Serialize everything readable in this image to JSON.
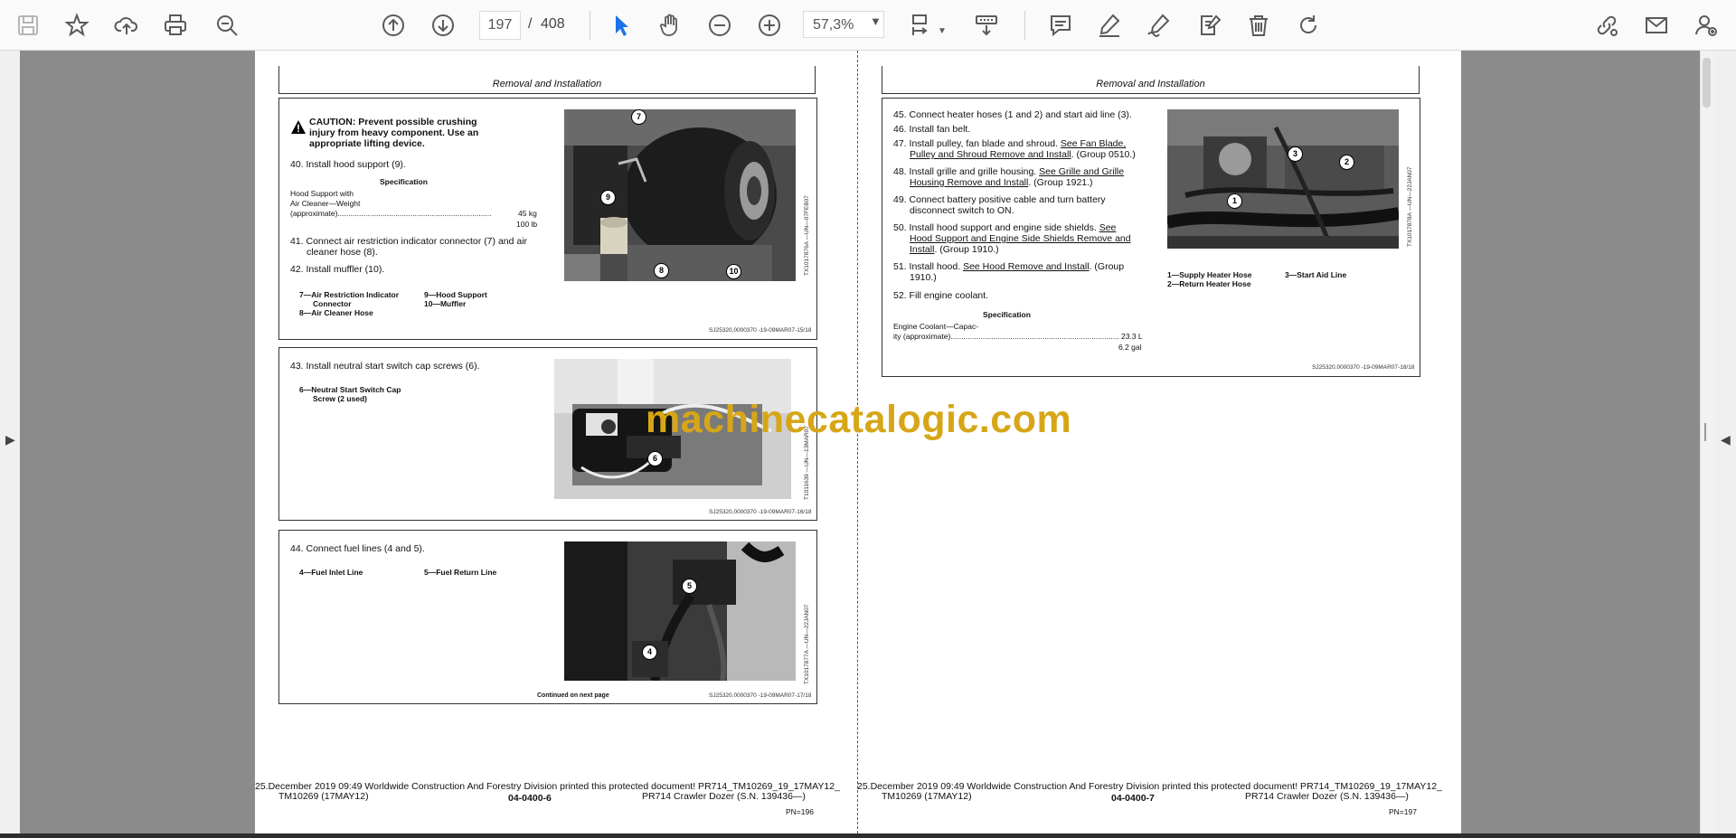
{
  "toolbar": {
    "icons": [
      "save-icon",
      "bookmark-star-icon",
      "upload-cloud-icon",
      "print-icon",
      "zoom-search-icon",
      "page-up-icon",
      "page-down-icon",
      "select-cursor-icon",
      "hand-pan-icon",
      "zoom-out-icon",
      "zoom-in-icon",
      "fit-page-icon",
      "scroll-mode-icon",
      "comment-icon",
      "highlight-pen-icon",
      "sign-pen-icon",
      "edit-document-icon",
      "delete-icon",
      "rotate-icon",
      "share-link-icon",
      "email-icon",
      "account-icon"
    ],
    "current_page": "197",
    "page_separator": "/",
    "total_pages": "408",
    "zoom": "57,3%"
  },
  "watermark": "machinecatalogic.com",
  "left_page": {
    "section_title": "Removal and Installation",
    "box1": {
      "caution": [
        "CAUTION: Prevent possible crushing",
        "injury from heavy component.  Use an",
        "appropriate lifting device."
      ],
      "step40": "40. Install hood support (9).",
      "spec_title": "Specification",
      "spec_lines": [
        "Hood Support with",
        "Air Cleaner—Weight",
        "(approximate)"
      ],
      "spec_value1": "45 kg",
      "spec_value2": "100 lb",
      "step41": [
        "41. Connect air restriction indicator connector (7) and air",
        "cleaner hose (8)."
      ],
      "step42": "42. Install muffler (10).",
      "legend_a": [
        "7—Air Restriction Indicator",
        "Connector",
        "8—Air Cleaner Hose"
      ],
      "legend_b": [
        "9—Hood Support",
        "10—Muffler"
      ],
      "photo_ref": "TX1017876A —UN—07FEB07",
      "doc_ref": "SJ25320,0000370 -19-09MAR07-15/18",
      "callouts": [
        "7",
        "9",
        "8",
        "10"
      ]
    },
    "box2": {
      "step43": "43.  Install neutral start switch cap screws (6).",
      "legend": [
        "6—Neutral Start Switch Cap",
        "Screw (2 used)"
      ],
      "photo_ref": "T1011639 —UN—13MAR07",
      "doc_ref": "SJ25320,0000370 -19-09MAR07-16/18",
      "callouts": [
        "6"
      ]
    },
    "box3": {
      "step44": "44.  Connect fuel lines (4 and 5).",
      "legend_a": "4—Fuel Inlet Line",
      "legend_b": "5—Fuel Return Line",
      "continued": "Continued on next page",
      "photo_ref": "TX1017877A —UN—22JAN07",
      "doc_ref": "SJ25320,0000370 -19-09MAR07-17/18",
      "callouts": [
        "5",
        "4"
      ]
    },
    "footer": {
      "printed": "25.December 2019 09:49 Worldwide Construction And Forestry Division printed this protected document! PR714_TM10269_19_17MAY12_",
      "manual": "TM10269 (17MAY12)",
      "page_no": "04-0400-6",
      "model": "PR714 Crawler Dozer (S.N. 139436—)",
      "pn": "PN=196"
    }
  },
  "right_page": {
    "section_title": "Removal and Installation",
    "steps": [
      {
        "n": "45.",
        "text": "Connect heater hoses (1 and 2) and start aid line (3)."
      },
      {
        "n": "46.",
        "text": "Install fan belt."
      },
      {
        "n": "47.",
        "text_a": "Install pulley, fan blade and shroud. ",
        "link_a": "See Fan Blade,",
        "link_b": "Pulley and Shroud Remove and Install",
        "text_b": ". (Group 0510.)"
      },
      {
        "n": "48.",
        "text_a": "Install grille and grille housing. ",
        "link_a": "See Grille and Grille",
        "link_b": "Housing Remove and Install",
        "text_b": ". (Group 1921.)"
      },
      {
        "n": "49.",
        "text_a": "Connect battery positive cable and turn battery",
        "text_b": "disconnect switch to ON."
      },
      {
        "n": "50.",
        "text_a": "Install hood support and engine side shields. ",
        "link_a": "See",
        "link_b": "Hood Support and Engine Side Shields Remove and",
        "link_c": "Install",
        "text_b": ". (Group 1910.)"
      },
      {
        "n": "51.",
        "text_a": "Install hood. ",
        "link_a": "See Hood Remove and Install",
        "text_b": ". (Group",
        "text_c": "1910.)"
      },
      {
        "n": "52.",
        "text": "Fill engine coolant."
      }
    ],
    "spec_title": "Specification",
    "spec_lines": [
      "Engine Coolant—Capac-",
      "ity (approximate)"
    ],
    "spec_value1": "23.3 L",
    "spec_value2": "6.2 gal",
    "legend_a": [
      "1—Supply Heater Hose",
      "2—Return Heater Hose"
    ],
    "legend_b": "3—Start Aid Line",
    "photo_ref": "TX1017878A —UN—22JAN07",
    "doc_ref": "SJ25320,0000370 -19-09MAR07-18/18",
    "callouts": [
      "3",
      "2",
      "1"
    ],
    "footer": {
      "printed": "25.December 2019 09:49 Worldwide Construction And Forestry Division printed this protected document! PR714_TM10269_19_17MAY12_",
      "manual": "TM10269 (17MAY12)",
      "page_no": "04-0400-7",
      "model": "PR714 Crawler Dozer (S.N. 139436—)",
      "pn": "PN=197"
    }
  }
}
